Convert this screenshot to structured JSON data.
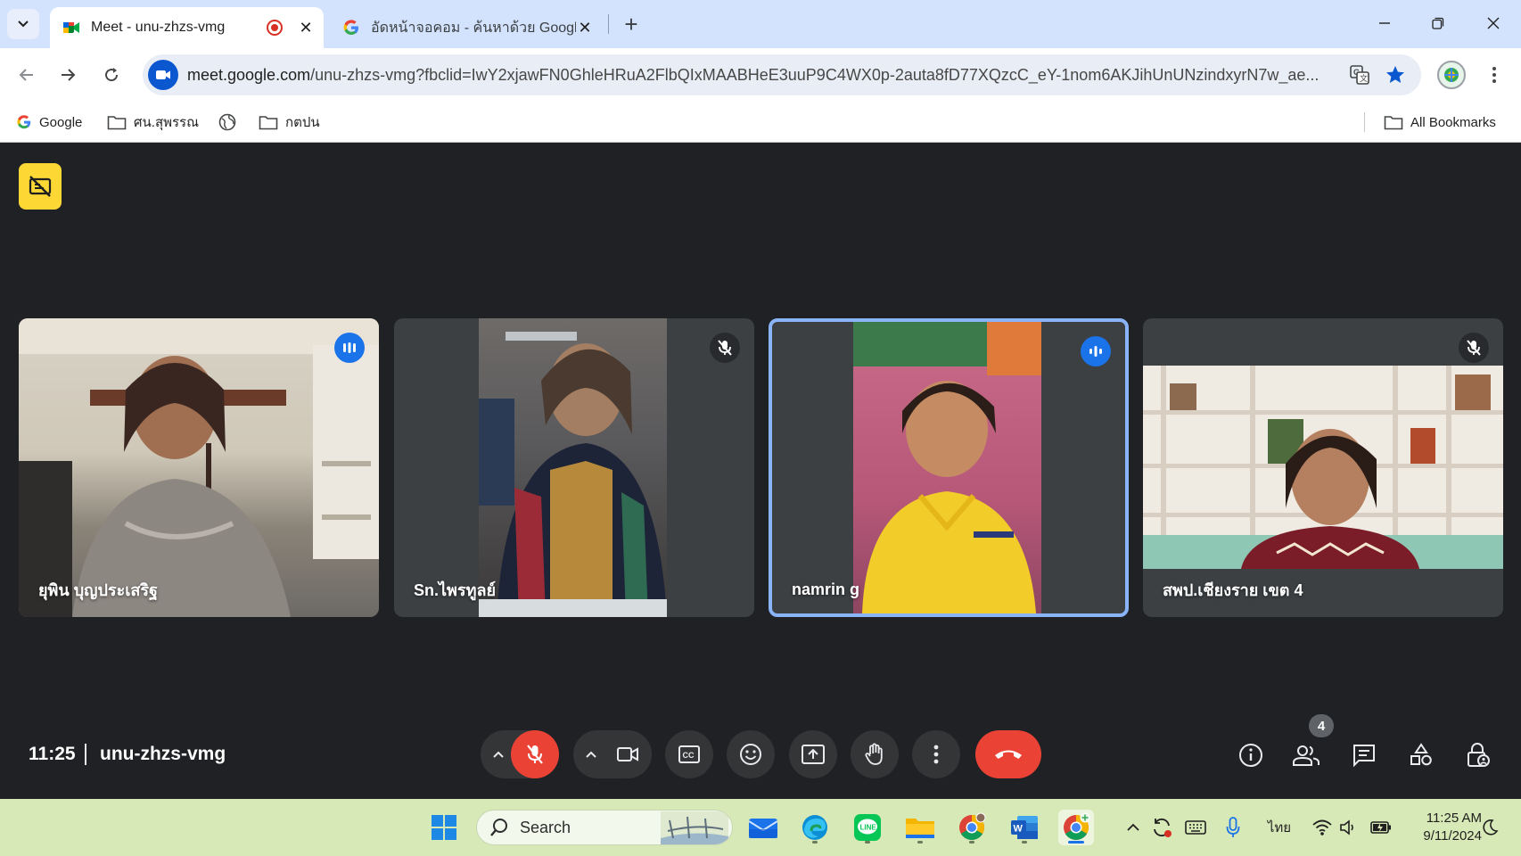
{
  "browser": {
    "tabs": [
      {
        "title": "Meet - unu-zhzs-vmg",
        "active": true,
        "recording": true
      },
      {
        "title": "อัดหน้าจอคอม - ค้นหาด้วย Google",
        "active": false
      }
    ],
    "address": {
      "url_host": "meet.google.com",
      "url_rest": "/unu-zhzs-vmg?fbclid=IwY2xjawFN0GhleHRuA2FlbQIxMAABHeE3uuP9C4WX0p-2auta8fD77XQzcC_eY-1nom6AKJihUnUNzindxyrN7w_ae..."
    },
    "bookmarks": [
      {
        "label": "Google",
        "icon": "google-icon"
      },
      {
        "label": "ศน.สุพรรณ",
        "icon": "folder-icon"
      },
      {
        "label": "",
        "icon": "globe-icon"
      },
      {
        "label": "กตปน",
        "icon": "folder-icon"
      }
    ],
    "all_bookmarks_label": "All Bookmarks"
  },
  "meet": {
    "time": "11:25",
    "code": "unu-zhzs-vmg",
    "participants": [
      {
        "name": "ยุพิน บุญประเสริฐ",
        "status": "speaking",
        "highlighted": false
      },
      {
        "name": "Sn.ไพรทูลย์",
        "status": "muted",
        "highlighted": false
      },
      {
        "name": "namrin g",
        "status": "speaking",
        "highlighted": true
      },
      {
        "name": "สพป.เชียงราย เขต 4",
        "status": "muted",
        "highlighted": false
      }
    ],
    "people_count": "4",
    "mic_muted": true,
    "colors": {
      "accent": "#1a73e8",
      "danger": "#ea4335",
      "badge": "#fdd835",
      "background": "#202124",
      "tile": "#3c4043"
    }
  },
  "taskbar": {
    "search_placeholder": "Search",
    "language": "ไทย",
    "clock_time": "11:25 AM",
    "clock_date": "9/11/2024"
  }
}
